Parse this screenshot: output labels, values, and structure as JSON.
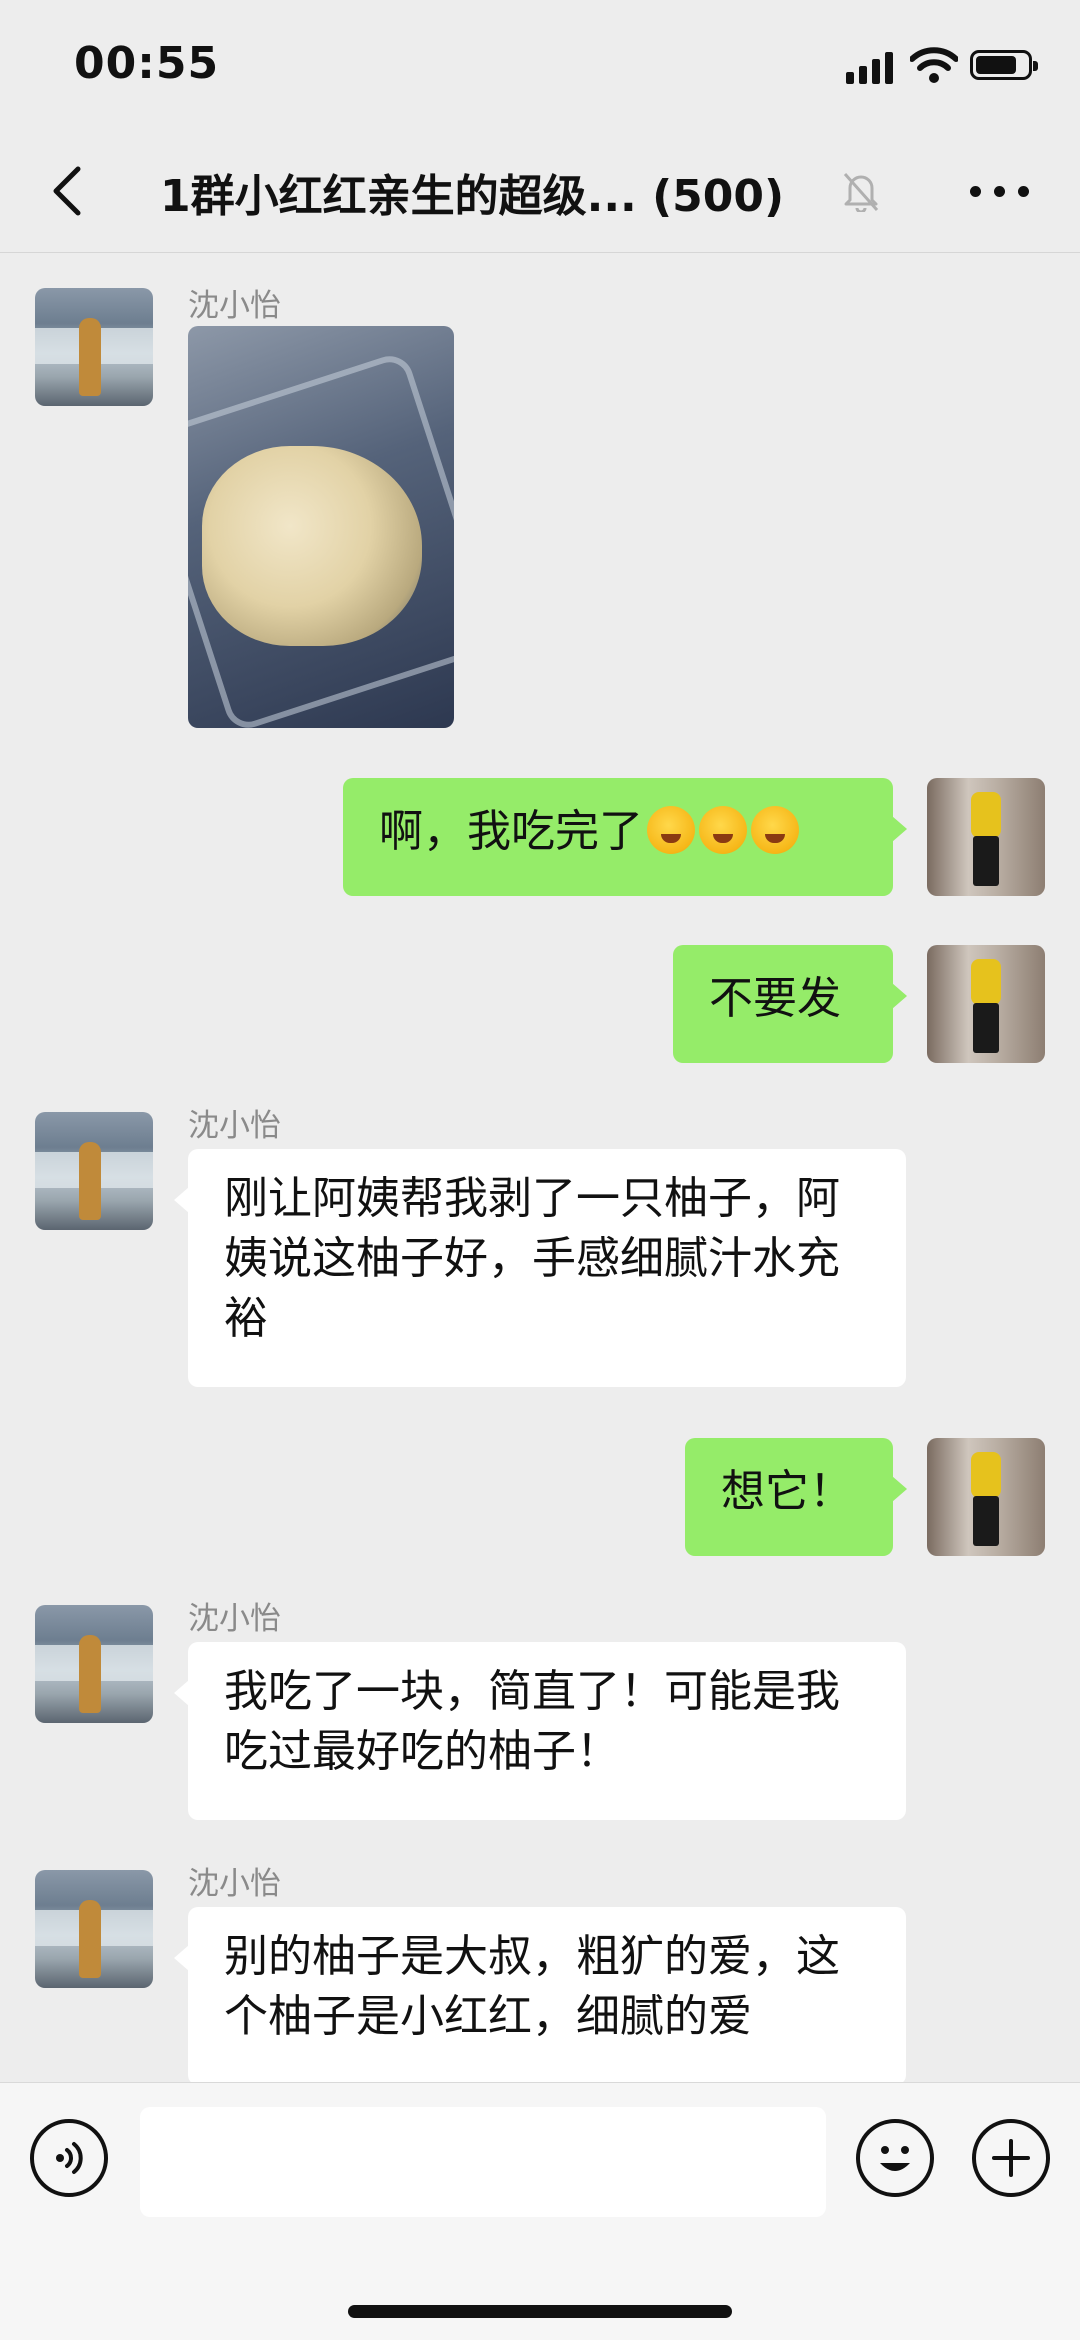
{
  "status_bar": {
    "time": "00:55"
  },
  "header": {
    "title": "1群小红红亲生的超级... (500)",
    "back_icon": "chevron-left-icon",
    "mute_icon": "bell-off-icon",
    "more_icon": "ellipsis-icon"
  },
  "messages": [
    {
      "side": "left",
      "sender": "沈小怡",
      "type": "image",
      "image_desc_icon": "photo-pomelo-pulp"
    },
    {
      "side": "right",
      "text": "啊，我吃完了",
      "emoji_count": 3
    },
    {
      "side": "right",
      "text": "不要发"
    },
    {
      "side": "left",
      "sender": "沈小怡",
      "text": "刚让阿姨帮我剥了一只柚子，阿姨说这柚子好，手感细腻汁水充裕"
    },
    {
      "side": "right",
      "text": "想它！"
    },
    {
      "side": "left",
      "sender": "沈小怡",
      "text": "我吃了一块，简直了！可能是我吃过最好吃的柚子！"
    },
    {
      "side": "left",
      "sender": "沈小怡",
      "text": "别的柚子是大叔，粗犷的爱，这个柚子是小红红，细腻的爱"
    }
  ],
  "input_bar": {
    "voice_icon": "voice-icon",
    "emoji_icon": "smiley-icon",
    "plus_icon": "plus-icon",
    "placeholder": ""
  },
  "colors": {
    "background": "#ededed",
    "outgoing_bubble": "#95ec69",
    "incoming_bubble": "#ffffff",
    "sender_name": "#8a8a8a"
  }
}
